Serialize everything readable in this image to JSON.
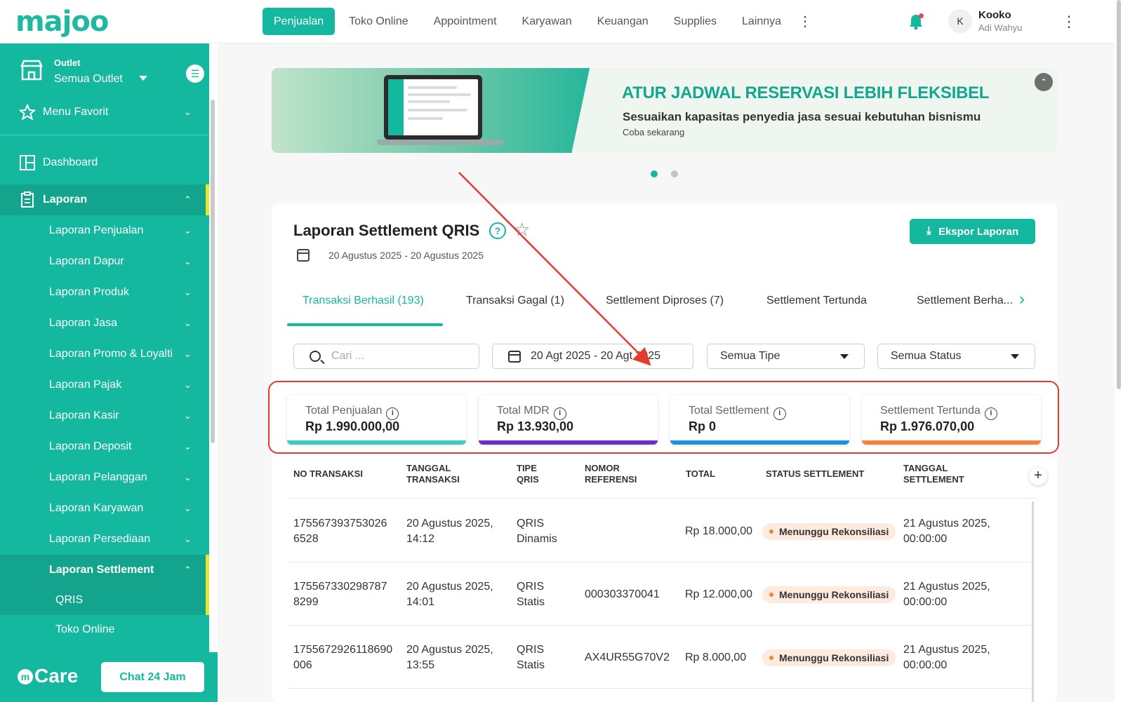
{
  "app": {
    "logo": "majoo",
    "nav": [
      "Penjualan",
      "Toko Online",
      "Appointment",
      "Karyawan",
      "Keuangan",
      "Supplies",
      "Lainnya"
    ],
    "user": {
      "initial": "K",
      "name": "Kooko",
      "subtitle": "Adi Wahyu"
    }
  },
  "sidebar": {
    "outlet_label": "Outlet",
    "outlet_value": "Semua Outlet",
    "menu_favorit": "Menu Favorit",
    "dashboard": "Dashboard",
    "laporan": "Laporan",
    "laporan_items": [
      "Laporan Penjualan",
      "Laporan Dapur",
      "Laporan Produk",
      "Laporan Jasa",
      "Laporan Promo & Loyalti",
      "Laporan Pajak",
      "Laporan Kasir",
      "Laporan Deposit",
      "Laporan Pelanggan",
      "Laporan Karyawan",
      "Laporan Persediaan",
      "Laporan Settlement"
    ],
    "settlement_sub": [
      "QRIS",
      "Toko Online"
    ],
    "care_logo": "Care",
    "care_button": "Chat 24 Jam"
  },
  "banner": {
    "title": "ATUR JADWAL RESERVASI LEBIH FLEKSIBEL",
    "subtitle": "Sesuaikan kapasitas penyedia jasa sesuai kebutuhan bisnismu",
    "cta": "Coba sekarang"
  },
  "report": {
    "title": "Laporan Settlement QRIS",
    "date_range": "20 Agustus 2025 - 20 Agustus 2025",
    "export_label": "Ekspor Laporan",
    "tabs": [
      "Transaksi Berhasil (193)",
      "Transaksi Gagal (1)",
      "Settlement Diproses (7)",
      "Settlement Tertunda",
      "Settlement Berha..."
    ],
    "search_placeholder": "Cari ...",
    "date_filter": "20 Agt 2025 - 20 Agt 2025",
    "type_filter": "Semua Tipe",
    "status_filter": "Semua Status",
    "stats": [
      {
        "label": "Total Penjualan",
        "value": "Rp 1.990.000,00",
        "color": "#3ecdb4"
      },
      {
        "label": "Total MDR",
        "value": "Rp 13.930,00",
        "color": "#6a2fc6"
      },
      {
        "label": "Total Settlement",
        "value": "Rp 0",
        "color": "#1f8fe0"
      },
      {
        "label": "Settlement Tertunda",
        "value": "Rp 1.976.070,00",
        "color": "#f0843a"
      }
    ],
    "columns": [
      "NO TRANSAKSI",
      "TANGGAL TRANSAKSI",
      "TIPE QRIS",
      "NOMOR REFERENSI",
      "TOTAL",
      "STATUS SETTLEMENT",
      "TANGGAL SETTLEMENT"
    ],
    "rows": [
      {
        "no_1": "175567393753026",
        "no_2": "6528",
        "tgl_1": "20 Agustus 2025,",
        "tgl_2": "14:12",
        "tipe_1": "QRIS",
        "tipe_2": "Dinamis",
        "ref": "",
        "total": "Rp 18.000,00",
        "status": "Menunggu Rekonsiliasi",
        "set_1": "21 Agustus 2025,",
        "set_2": "00:00:00"
      },
      {
        "no_1": "175567330298787",
        "no_2": "8299",
        "tgl_1": "20 Agustus 2025,",
        "tgl_2": "14:01",
        "tipe_1": "QRIS",
        "tipe_2": "Statis",
        "ref": "000303370041",
        "total": "Rp 12.000,00",
        "status": "Menunggu Rekonsiliasi",
        "set_1": "21 Agustus 2025,",
        "set_2": "00:00:00"
      },
      {
        "no_1": "1755672926118690",
        "no_2": "006",
        "tgl_1": "20 Agustus 2025,",
        "tgl_2": "13:55",
        "tipe_1": "QRIS",
        "tipe_2": "Statis",
        "ref": "AX4UR55G70V2",
        "total": "Rp 8.000,00",
        "status": "Menunggu Rekonsiliasi",
        "set_1": "21 Agustus 2025,",
        "set_2": "00:00:00"
      }
    ]
  },
  "colors": {
    "brand": "#14b89f",
    "annotation": "#e53b2f"
  }
}
